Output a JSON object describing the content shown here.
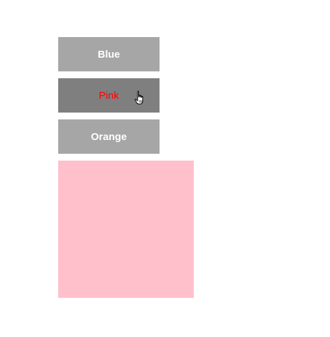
{
  "buttons": [
    {
      "label": "Blue",
      "state": "normal"
    },
    {
      "label": "Pink",
      "state": "hover"
    },
    {
      "label": "Orange",
      "state": "normal"
    }
  ],
  "preview": {
    "color": "#ffc0cb"
  },
  "colors": {
    "button_bg": "#a6a6a6",
    "button_hover_bg": "#7f7f7f",
    "button_text": "#ffffff",
    "hover_text": "#ff0000"
  },
  "cursor": {
    "icon": "hand-pointer-icon"
  }
}
